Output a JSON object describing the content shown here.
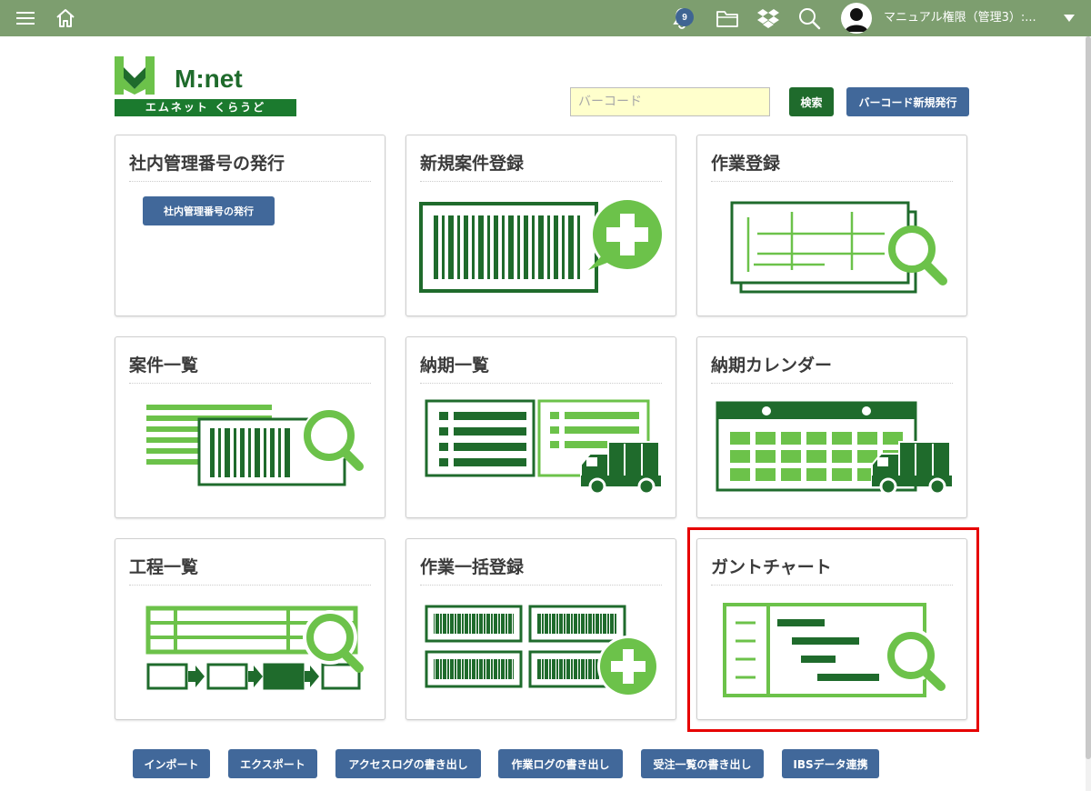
{
  "topbar": {
    "notification_count": "9",
    "user_name": "マニュアル権限（管理3）:..."
  },
  "logo": {
    "brand": "M:net",
    "subtitle": "エムネット くらうど"
  },
  "search": {
    "placeholder": "バーコード",
    "search_label": "検索",
    "new_barcode_label": "バーコード新規発行"
  },
  "cards": [
    {
      "title": "社内管理番号の発行",
      "button_label": "社内管理番号の発行"
    },
    {
      "title": "新規案件登録"
    },
    {
      "title": "作業登録"
    },
    {
      "title": "案件一覧"
    },
    {
      "title": "納期一覧"
    },
    {
      "title": "納期カレンダー"
    },
    {
      "title": "工程一覧"
    },
    {
      "title": "作業一括登録"
    },
    {
      "title": "ガントチャート"
    }
  ],
  "bottom_buttons": [
    "インポート",
    "エクスポート",
    "アクセスログの書き出し",
    "作業ログの書き出し",
    "受注一覧の書き出し",
    "IBSデータ連携"
  ],
  "colors": {
    "topbar": "#7d9e6f",
    "dark_green": "#1f6b2c",
    "light_green": "#6cc24a",
    "blue_button": "#41689a",
    "highlight": "#e60000"
  },
  "icons": [
    "menu-icon",
    "home-icon",
    "bell-icon",
    "folder-icon",
    "dropbox-icon",
    "search-icon",
    "avatar-icon",
    "caret-down-icon"
  ]
}
